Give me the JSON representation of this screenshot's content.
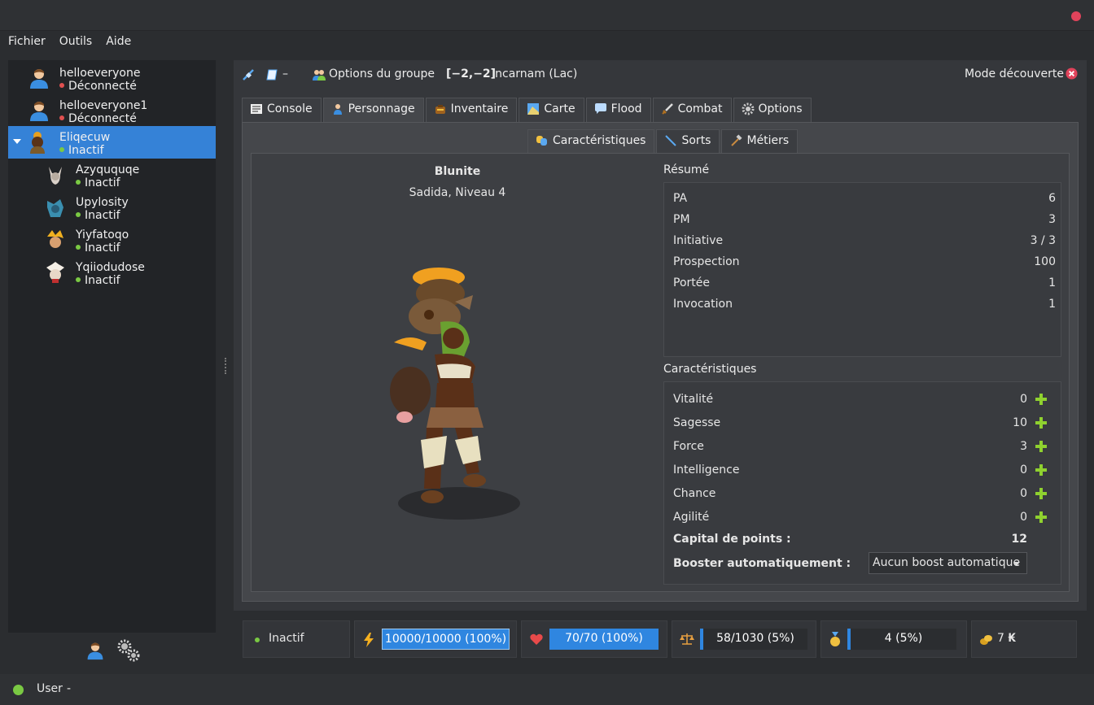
{
  "menu": [
    "Fichier",
    "Outils",
    "Aide"
  ],
  "accounts": [
    {
      "name": "helloeveryone",
      "status": "Déconnecté",
      "state": "red"
    },
    {
      "name": "helloeveryone1",
      "status": "Déconnecté",
      "state": "red"
    }
  ],
  "selected_account": {
    "name": "Eliqecuw",
    "status": "Inactif"
  },
  "characters": [
    {
      "name": "Azyququqe",
      "status": "Inactif"
    },
    {
      "name": "Upylosity",
      "status": "Inactif"
    },
    {
      "name": "Yiyfatoqo",
      "status": "Inactif"
    },
    {
      "name": "Yqiiodudose",
      "status": "Inactif"
    }
  ],
  "toolbar": {
    "dash": "–",
    "group_options": "Options du groupe",
    "coords": "[−2,−2]",
    "location": "Incarnam (Lac)",
    "mode": "Mode découverte"
  },
  "tabs": [
    "Console",
    "Personnage",
    "Inventaire",
    "Carte",
    "Flood",
    "Combat",
    "Options"
  ],
  "subtabs": [
    "Caractéristiques",
    "Sorts",
    "Métiers"
  ],
  "character": {
    "name": "Blunite",
    "subtitle": "Sadida, Niveau 4"
  },
  "summary": {
    "title": "Résumé",
    "rows": [
      {
        "label": "PA",
        "value": "6"
      },
      {
        "label": "PM",
        "value": "3"
      },
      {
        "label": "Initiative",
        "value": "3 / 3"
      },
      {
        "label": "Prospection",
        "value": "100"
      },
      {
        "label": "Portée",
        "value": "1"
      },
      {
        "label": "Invocation",
        "value": "1"
      }
    ]
  },
  "stats": {
    "title": "Caractéristiques",
    "rows": [
      {
        "label": "Vitalité",
        "value": "0"
      },
      {
        "label": "Sagesse",
        "value": "10"
      },
      {
        "label": "Force",
        "value": "3"
      },
      {
        "label": "Intelligence",
        "value": "0"
      },
      {
        "label": "Chance",
        "value": "0"
      },
      {
        "label": "Agilité",
        "value": "0"
      }
    ],
    "capital_label": "Capital de points :",
    "capital_value": "12",
    "booster_label": "Booster automatiquement :",
    "booster_value": "Aucun boost automatique"
  },
  "bottom": {
    "status": "Inactif",
    "energy": "10000/10000 (100%)",
    "life": "70/70 (100%)",
    "pods": "58/1030 (5%)",
    "pods_fraction": 0.05,
    "xp": "4 (5%)",
    "xp_fraction": 0.05,
    "kamas": "7",
    "kamas_symbol": "₭"
  },
  "statusbar": {
    "user": "User",
    "dash": "-"
  }
}
